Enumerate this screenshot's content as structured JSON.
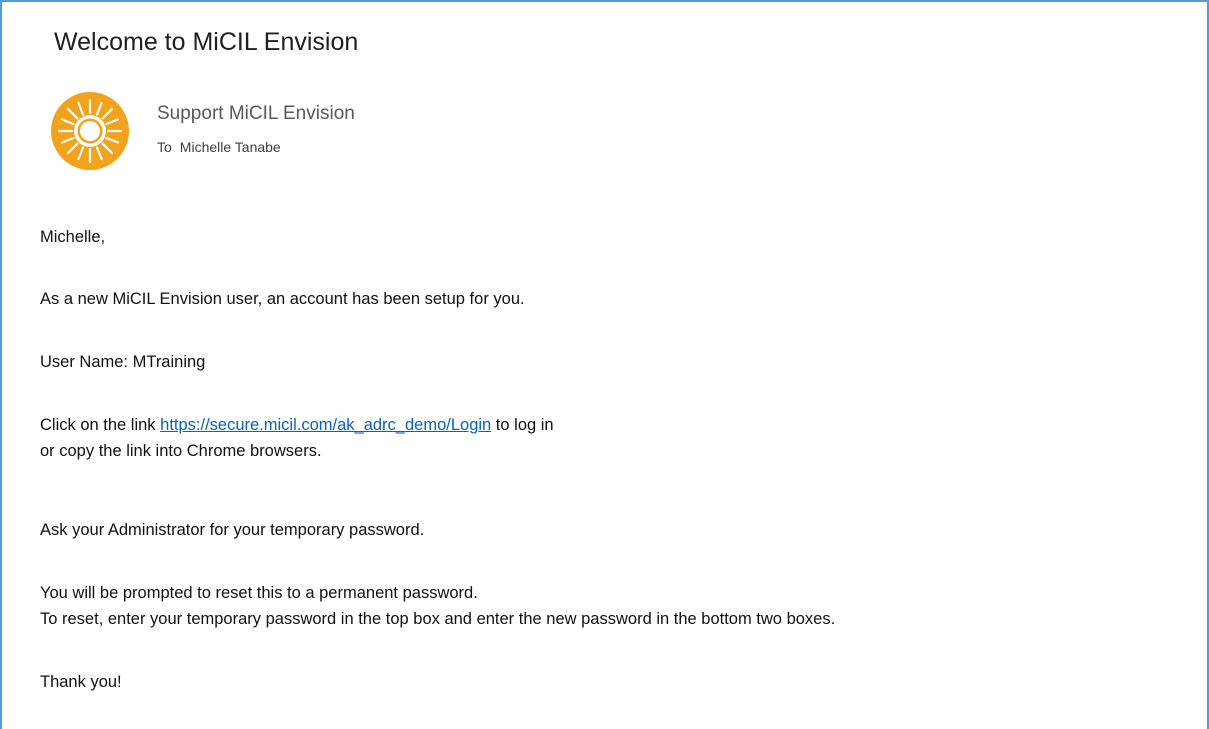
{
  "email": {
    "subject": "Welcome to MiCIL Envision",
    "sender_name": "Support MiCIL Envision",
    "to_label": "To",
    "recipient": "Michelle Tanabe",
    "avatar_icon": "sun-logo-icon",
    "colors": {
      "accent_border": "#5b9bd5",
      "avatar_orange": "#f3a21b",
      "link": "#0563c1"
    }
  },
  "body": {
    "greeting": "Michelle,",
    "intro": "As a new MiCIL Envision user, an account has been setup for you.",
    "username_line": "User Name: MTraining",
    "link_prefix": "Click on the link ",
    "link_text": "https://secure.micil.com/ak_adrc_demo/Login",
    "link_suffix": " to log in",
    "copy_line": "or copy the link into Chrome browsers.",
    "ask_admin": "Ask your Administrator for your temporary password.",
    "prompt_reset": "You will be prompted to reset this to a permanent password.",
    "reset_instructions": "To reset, enter your temporary password in the top box and enter the new password in the bottom two boxes.",
    "closing": "Thank you!"
  }
}
